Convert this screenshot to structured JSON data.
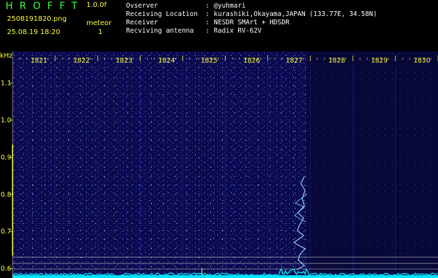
{
  "app": {
    "title": "HROFFT",
    "version": "1.0.0f",
    "filename": "2508191820.png",
    "datetime": "25.08.19 18:20",
    "mode": "meteor",
    "count": "1"
  },
  "info": [
    {
      "label": "Ovserver",
      "value": "@yuhmari"
    },
    {
      "label": "Receiving Location",
      "value": "kurashiki,Okayama,JAPAN (133.77E, 34.58N)"
    },
    {
      "label": "Receiver",
      "value": "NESDR SMArt + HDSDR"
    },
    {
      "label": "Recviving antenna",
      "value": "Radix RV-62V"
    }
  ],
  "separator": ":",
  "chart_data": {
    "type": "heatmap",
    "ylabel": "kHz",
    "x_ticks": [
      "1821",
      "1822",
      "1823",
      "1824",
      "1825",
      "1826",
      "1827",
      "1828",
      "1829",
      "1830"
    ],
    "y_ticks": [
      "1.1",
      "1.0",
      "0.9",
      "0.8",
      "0.7",
      "0.6"
    ],
    "ylim": [
      0.575,
      1.185
    ],
    "colors": {
      "background": "#0a0a48",
      "noise": "#3a4aff",
      "signal": "#90d8ff",
      "spectrum": "#00e4ff",
      "tick_text": "#ffff40"
    }
  }
}
